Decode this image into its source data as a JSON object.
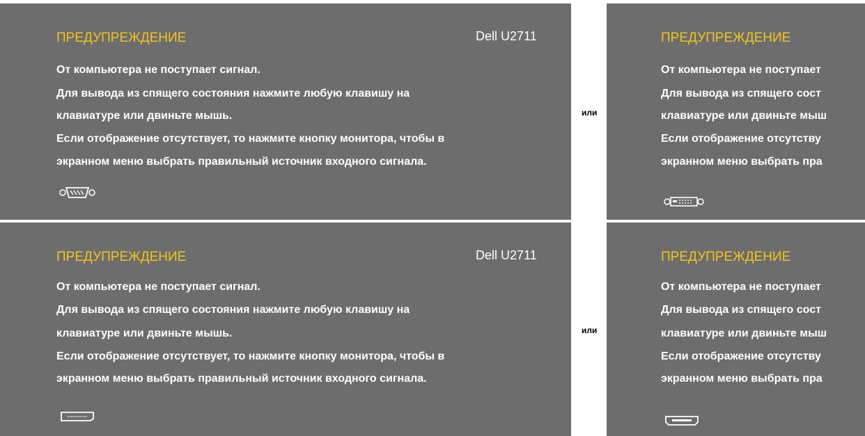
{
  "panels": [
    {
      "title": "ПРЕДУПРЕЖДЕНИЕ",
      "model": "Dell U2711",
      "lines": [
        "От компьютера не поступает сигнал.",
        "Для вывода из спящего состояния нажмите любую клавишу на",
        "клавиатуре или двиньте мышь.",
        "Если отображение отсутствует, то нажмите кнопку монитора, чтобы в",
        "экранном меню выбрать правильный источник входного сигнала."
      ],
      "icon": "vga-connector-icon"
    },
    {
      "title": "ПРЕДУПРЕЖДЕНИЕ",
      "lines": [
        "От компьютера не поступает",
        "Для вывода из спящего сост",
        "клавиатуре или двиньте мыш",
        "Если отображение отсутству",
        "экранном меню выбрать пра"
      ],
      "icon": "dvi-connector-icon"
    },
    {
      "title": "ПРЕДУПРЕЖДЕНИЕ",
      "model": "Dell U2711",
      "lines": [
        "От компьютера не поступает сигнал.",
        "Для вывода из спящего состояния нажмите любую клавишу на",
        "клавиатуре или двиньте мышь.",
        "Если отображение отсутствует, то нажмите кнопку монитора, чтобы в",
        "экранном меню выбрать правильный источник входного сигнала."
      ],
      "icon": "displayport-connector-icon"
    },
    {
      "title": "ПРЕДУПРЕЖДЕНИЕ",
      "lines": [
        "От компьютера не поступает",
        "Для вывода из спящего сост",
        "клавиатуре или двиньте мыш",
        "Если отображение отсутству",
        "экранном меню выбрать пра"
      ],
      "icon": "hdmi-connector-icon"
    }
  ],
  "or_label": "или"
}
